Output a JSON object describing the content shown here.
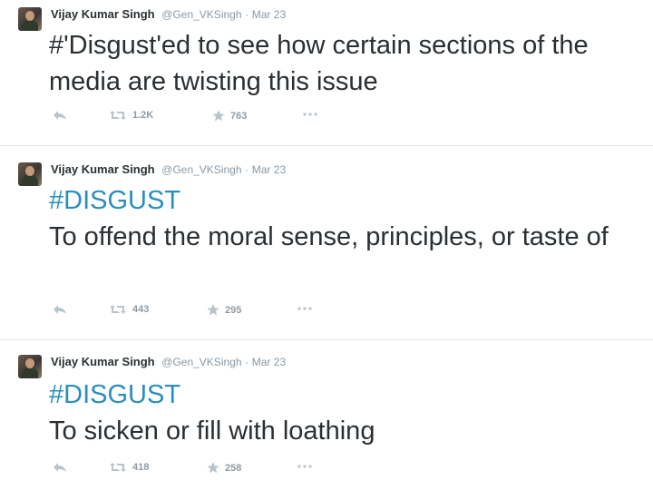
{
  "tweets": [
    {
      "author_name": "Vijay Kumar Singh",
      "handle": "@Gen_VKSingh",
      "separator": "·",
      "date": "Mar 23",
      "hashtag": "",
      "text": "#'Disgust'ed to see how certain sections of the media are twisting this issue",
      "retweets": "1.2K",
      "favorites": "763"
    },
    {
      "author_name": "Vijay Kumar Singh",
      "handle": "@Gen_VKSingh",
      "separator": "·",
      "date": "Mar 23",
      "hashtag": "#DISGUST",
      "text": "To offend the moral sense, principles, or taste of",
      "retweets": "443",
      "favorites": "295"
    },
    {
      "author_name": "Vijay Kumar Singh",
      "handle": "@Gen_VKSingh",
      "separator": "·",
      "date": "Mar 23",
      "hashtag": "#DISGUST",
      "text": "To sicken or fill with loathing",
      "retweets": "418",
      "favorites": "258"
    }
  ],
  "icons": {
    "reply": "reply-icon",
    "retweet": "retweet-icon",
    "favorite": "star-icon",
    "more": "more-dots-icon"
  },
  "colors": {
    "hashtag": "#2b8fbb",
    "meta": "#8899a6",
    "action_icon": "#b8c4cc",
    "text": "#292f33"
  }
}
